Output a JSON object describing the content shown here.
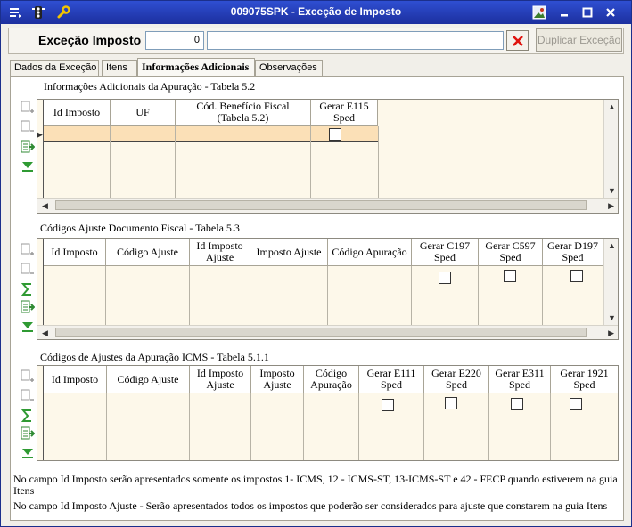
{
  "window": {
    "title": "009075SPK - Exceção de Imposto"
  },
  "toolbar": {
    "label": "Exceção Imposto",
    "code_value": "0",
    "description_value": "",
    "duplicate_label": "Duplicar Exceção"
  },
  "tabs": [
    {
      "label": "Dados da Exceção",
      "active": false
    },
    {
      "label": "Itens",
      "active": false
    },
    {
      "label": "Informações Adicionais",
      "active": true
    },
    {
      "label": "Observações",
      "active": false
    }
  ],
  "section1": {
    "title": "Informações Adicionais da Apuração - Tabela 5.2",
    "columns": [
      {
        "lines": [
          "Id Imposto"
        ]
      },
      {
        "lines": [
          "UF"
        ]
      },
      {
        "lines": [
          "Cód. Benefício Fiscal",
          "(Tabela 5.2)"
        ]
      },
      {
        "lines": [
          "Gerar E115",
          "Sped"
        ]
      }
    ]
  },
  "section2": {
    "title": "Códigos Ajuste Documento Fiscal - Tabela 5.3",
    "columns": [
      {
        "lines": [
          "Id Imposto"
        ]
      },
      {
        "lines": [
          "Código Ajuste"
        ]
      },
      {
        "lines": [
          "Id Imposto",
          "Ajuste"
        ]
      },
      {
        "lines": [
          "Imposto Ajuste"
        ]
      },
      {
        "lines": [
          "Código Apuração"
        ]
      },
      {
        "lines": [
          "Gerar C197",
          "Sped"
        ]
      },
      {
        "lines": [
          "Gerar C597",
          "Sped"
        ]
      },
      {
        "lines": [
          "Gerar D197",
          "Sped"
        ]
      }
    ]
  },
  "section3": {
    "title": "Códigos de Ajustes da Apuração ICMS - Tabela 5.1.1",
    "columns": [
      {
        "lines": [
          "Id Imposto"
        ]
      },
      {
        "lines": [
          "Código Ajuste"
        ]
      },
      {
        "lines": [
          "Id Imposto",
          "Ajuste"
        ]
      },
      {
        "lines": [
          "Imposto",
          "Ajuste"
        ]
      },
      {
        "lines": [
          "Código",
          "Apuração"
        ]
      },
      {
        "lines": [
          "Gerar E111",
          "Sped"
        ]
      },
      {
        "lines": [
          "Gerar E220",
          "Sped"
        ]
      },
      {
        "lines": [
          "Gerar E311",
          "Sped"
        ]
      },
      {
        "lines": [
          "Gerar 1921",
          "Sped"
        ]
      }
    ]
  },
  "notes": [
    "No campo Id Imposto serão apresentados somente os impostos 1- ICMS, 12 - ICMS-ST, 13-ICMS-ST e 42 - FECP quando estiverem na guia Itens",
    "No campo Id Imposto Ajuste - Serão apresentados todos os impostos que poderão ser considerados para ajuste que constarem na guia Itens"
  ],
  "icons": {
    "title_menu": "menu-icon",
    "title_traffic": "traffic-light-icon",
    "title_tools": "wrench-icon",
    "grid_add": "add-row-icon",
    "grid_remove": "remove-row-icon",
    "grid_sum": "sum-icon",
    "grid_export": "export-icon",
    "grid_filter": "filter-icon"
  },
  "colors": {
    "titlebar": "#2f4fd2",
    "grid_background": "#fdf8ea",
    "selected_row": "#fbe0b7",
    "clear_icon": "#e0140f"
  }
}
